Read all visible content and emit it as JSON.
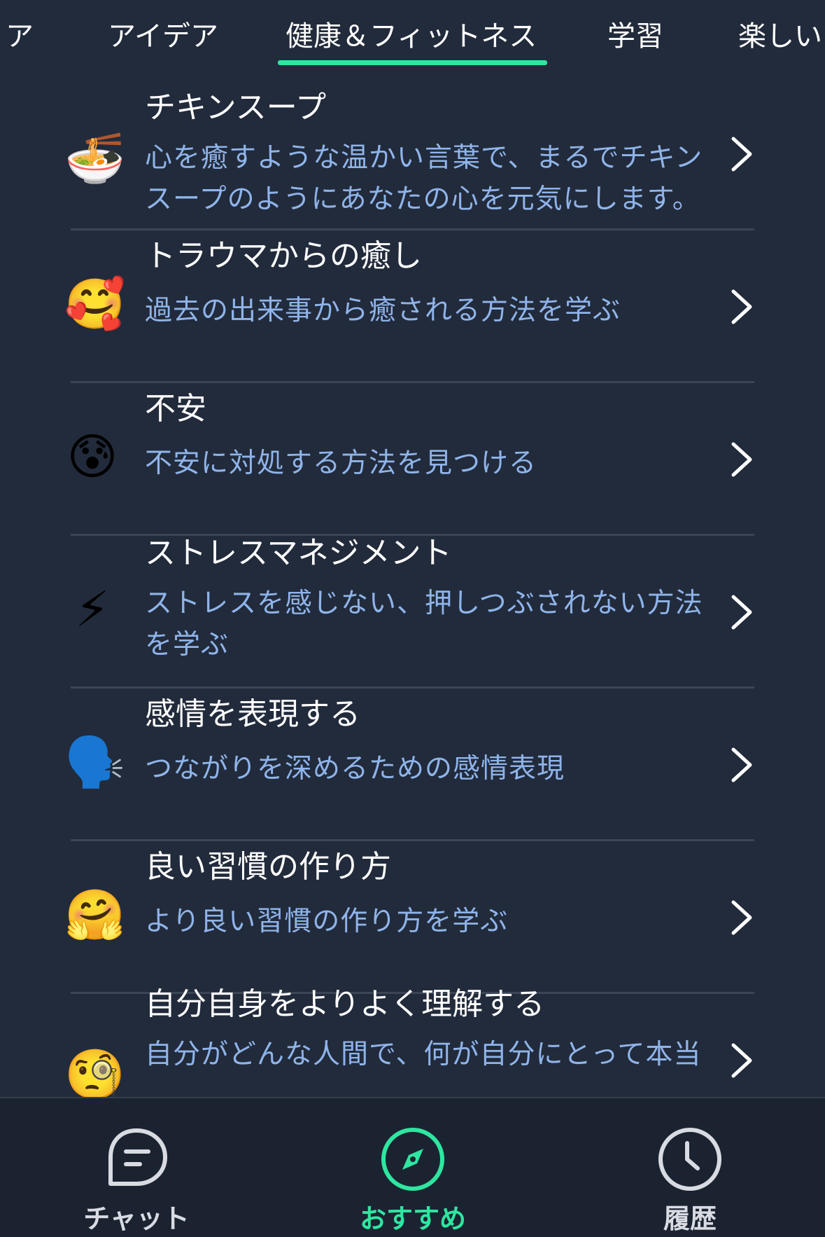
{
  "tabs": [
    {
      "label": "ア"
    },
    {
      "label": "アイデア"
    },
    {
      "label": "健康＆フィットネス",
      "active": true
    },
    {
      "label": "学習"
    },
    {
      "label": "楽しい"
    }
  ],
  "items": [
    {
      "emoji": "🍜",
      "icon": "ramen-bowl-icon",
      "title": "チキンスープ",
      "desc": "心を癒すような温かい言葉で、まるでチキンスープのようにあなたの心を元気にします。"
    },
    {
      "emoji": "🥰",
      "icon": "smiling-face-with-hearts-icon",
      "title": "トラウマからの癒し",
      "desc": "過去の出来事から癒される方法を学ぶ"
    },
    {
      "emoji": "😰",
      "icon": "anxious-face-icon",
      "title": "不安",
      "desc": "不安に対処する方法を見つける"
    },
    {
      "emoji": "⚡",
      "icon": "lightning-icon",
      "title": "ストレスマネジメント",
      "desc": "ストレスを感じない、押しつぶされない方法を学ぶ"
    },
    {
      "emoji": "🗣️",
      "icon": "speaking-head-icon",
      "title": "感情を表現する",
      "desc": "つながりを深めるための感情表現"
    },
    {
      "emoji": "🤗",
      "icon": "hugging-face-icon",
      "title": "良い習慣の作り方",
      "desc": "より良い習慣の作り方を学ぶ"
    },
    {
      "emoji": "🧐",
      "icon": "monocle-face-icon",
      "title": "自分自身をよりよく理解する",
      "desc": "自分がどんな人間で、何が自分にとって本当"
    }
  ],
  "bottom_nav": [
    {
      "label": "チャット",
      "icon": "chat-bubble-icon"
    },
    {
      "label": "おすすめ",
      "icon": "compass-icon",
      "active": true
    },
    {
      "label": "履歴",
      "icon": "clock-icon"
    }
  ],
  "colors": {
    "background": "#222b3b",
    "accent": "#2ee6a0",
    "description": "#8fb4ea",
    "nav_background": "#1b2331"
  }
}
